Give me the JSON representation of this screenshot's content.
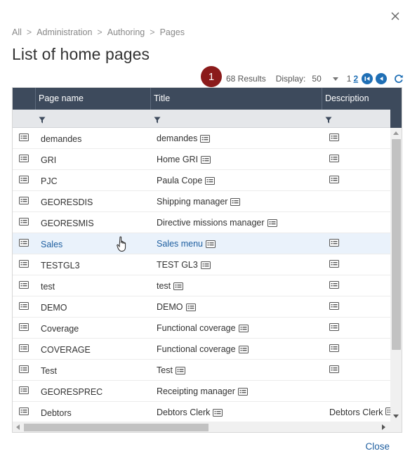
{
  "breadcrumb": [
    "All",
    "Administration",
    "Authoring",
    "Pages"
  ],
  "title": "List of home pages",
  "badge": "1",
  "toolbar": {
    "results": "68 Results",
    "display_label": "Display:",
    "display_value": "50",
    "page_1": "1",
    "page_2": "2"
  },
  "columns": {
    "page_name": "Page name",
    "title": "Title",
    "description": "Description"
  },
  "rows": [
    {
      "name": "demandes",
      "title": "demandes",
      "desc": ""
    },
    {
      "name": "GRI",
      "title": "Home GRI",
      "desc": ""
    },
    {
      "name": "PJC",
      "title": "Paula Cope",
      "desc": ""
    },
    {
      "name": "GEORESDIS",
      "title": "Shipping manager",
      "desc": ""
    },
    {
      "name": "GEORESMIS",
      "title": "Directive missions manager",
      "desc": ""
    },
    {
      "name": "Sales",
      "title": "Sales menu",
      "desc": ""
    },
    {
      "name": "TESTGL3",
      "title": "TEST GL3",
      "desc": ""
    },
    {
      "name": "test",
      "title": "test",
      "desc": ""
    },
    {
      "name": "DEMO",
      "title": "DEMO",
      "desc": ""
    },
    {
      "name": "Coverage",
      "title": "Functional coverage",
      "desc": ""
    },
    {
      "name": "COVERAGE",
      "title": "Functional coverage",
      "desc": ""
    },
    {
      "name": "Test",
      "title": "Test",
      "desc": ""
    },
    {
      "name": "GEORESPREC",
      "title": "Receipting manager",
      "desc": ""
    },
    {
      "name": "Debtors",
      "title": "Debtors Clerk",
      "desc": "Debtors Clerk"
    }
  ],
  "close_label": "Close",
  "colors": {
    "header_bg": "#3d4a5c",
    "accent": "#1f6fb5",
    "badge": "#8b1b1b",
    "selected_row": "#eaf2fb"
  },
  "icons": [
    "close-icon",
    "filter-icon",
    "record-icon",
    "translate-icon",
    "first-page-icon",
    "previous-page-icon",
    "refresh-icon",
    "hand-cursor-icon"
  ]
}
